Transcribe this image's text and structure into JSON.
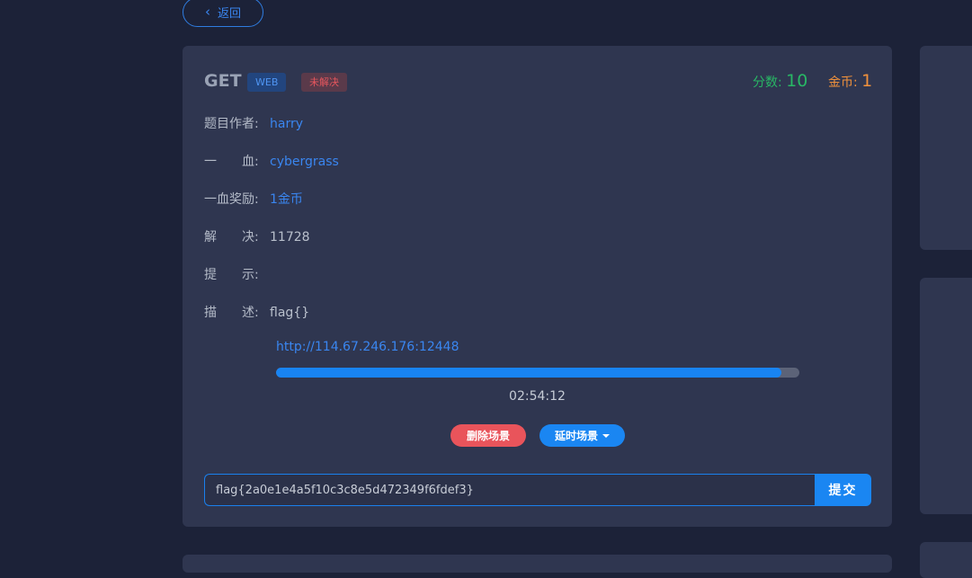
{
  "back": {
    "label": "返回"
  },
  "challenge": {
    "title": "GET",
    "category": "WEB",
    "status": "未解决",
    "score_label": "分数:",
    "score_value": "10",
    "coin_label": "金币:",
    "coin_value": "1",
    "author_label": "题目作者:",
    "author": "harry",
    "first_blood_label": "一　　血:",
    "first_blood": "cybergrass",
    "reward_label": "一血奖励:",
    "reward": "1金币",
    "solves_label": "解　　决:",
    "solves": "11728",
    "hint_label": "提　　示:",
    "hint": "",
    "desc_label": "描　　述:",
    "desc": "flag{}"
  },
  "scene": {
    "url": "http://114.67.246.176:12448",
    "progress_percent": 96.5,
    "timer": "02:54:12",
    "delete_label": "删除场景",
    "extend_label": "延时场景"
  },
  "submit": {
    "value": "flag{2a0e1e4a5f10c3c8e5d472349f6fdef3}",
    "button_label": "提交"
  },
  "colors": {
    "accent": "#1a86f2",
    "danger": "#e9545b",
    "score": "#28b765",
    "coin": "#f0913c"
  }
}
